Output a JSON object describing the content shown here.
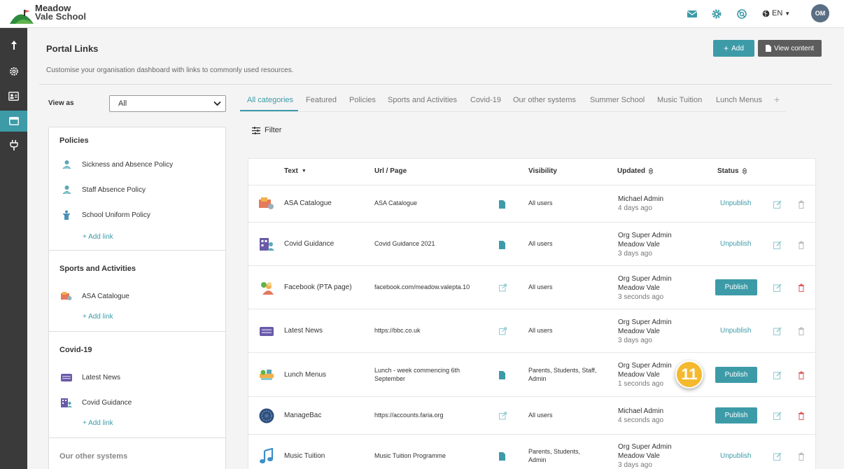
{
  "brand": {
    "line1": "Meadow",
    "line2": "Vale School"
  },
  "header": {
    "lang": "EN",
    "avatar": "OM"
  },
  "page": {
    "title": "Portal Links",
    "subtitle": "Customise your organisation dashboard with links to commonly used resources.",
    "add_label": "Add",
    "view_label": "View content"
  },
  "viewas": {
    "label": "View as",
    "value": "All"
  },
  "panel": {
    "sections": [
      {
        "head": "Policies",
        "links": [
          "Sickness and Absence Policy",
          "Staff Absence Policy",
          "School Uniform Policy"
        ],
        "add": "Add link"
      },
      {
        "head": "Sports and Activities",
        "links": [
          "ASA Catalogue"
        ],
        "add": "Add link"
      },
      {
        "head": "Covid-19",
        "links": [
          "Latest News",
          "Covid Guidance"
        ],
        "add": "Add link"
      },
      {
        "head": "Our other systems"
      }
    ]
  },
  "tabs": [
    "All categories",
    "Featured",
    "Policies",
    "Sports and Activities",
    "Covid-19",
    "Our other systems",
    "Summer School",
    "Music Tuition",
    "Lunch Menus",
    "+"
  ],
  "filter_label": "Filter",
  "table": {
    "headers": {
      "text": "Text",
      "url": "Url / Page",
      "visibility": "Visibility",
      "updated": "Updated",
      "status": "Status"
    },
    "rows": [
      {
        "text": "ASA Catalogue",
        "url": [
          "ASA Catalogue"
        ],
        "type": "page",
        "visibility": [
          "All users"
        ],
        "updated": [
          "Michael Admin"
        ],
        "ago": "4 days ago",
        "status": "Unpublish"
      },
      {
        "text": "Covid Guidance",
        "url": [
          "Covid Guidance 2021"
        ],
        "type": "page",
        "visibility": [
          "All users"
        ],
        "updated": [
          "Org Super Admin",
          "Meadow Vale"
        ],
        "ago": "3 days ago",
        "status": "Unpublish"
      },
      {
        "text": "Facebook (PTA page)",
        "url": [
          "facebook.com/meadow.valepta.10"
        ],
        "type": "link",
        "visibility": [
          "All users"
        ],
        "updated": [
          "Org Super Admin",
          "Meadow Vale"
        ],
        "ago": "3 seconds ago",
        "status": "Publish"
      },
      {
        "text": "Latest News",
        "url": [
          "https://bbc.co.uk"
        ],
        "type": "link",
        "visibility": [
          "All users"
        ],
        "updated": [
          "Org Super Admin",
          "Meadow Vale"
        ],
        "ago": "3 days ago",
        "status": "Unpublish"
      },
      {
        "text": "Lunch Menus",
        "url": [
          "Lunch - week commencing 6th",
          "September"
        ],
        "type": "page",
        "visibility": [
          "Parents, Students, Staff,",
          "Admin"
        ],
        "updated": [
          "Org Super Admin",
          "Meadow Vale"
        ],
        "ago": "1 seconds ago",
        "status": "Publish"
      },
      {
        "text": "ManageBac",
        "url": [
          "https://accounts.faria.org"
        ],
        "type": "link",
        "visibility": [
          "All users"
        ],
        "updated": [
          "Michael Admin"
        ],
        "ago": "4 seconds ago",
        "status": "Publish"
      },
      {
        "text": "Music Tuition",
        "url": [
          "Music Tuition Programme"
        ],
        "type": "page",
        "visibility": [
          "Parents, Students,",
          "Admin"
        ],
        "updated": [
          "Org Super Admin",
          "Meadow Vale"
        ],
        "ago": "3 days ago",
        "status": "Unpublish"
      }
    ]
  },
  "badge": "11",
  "colors": {
    "accent": "#3d9ba8",
    "sidebar": "#3a3a3a",
    "badge": "#f5b92e",
    "danger": "#e05a5a"
  }
}
